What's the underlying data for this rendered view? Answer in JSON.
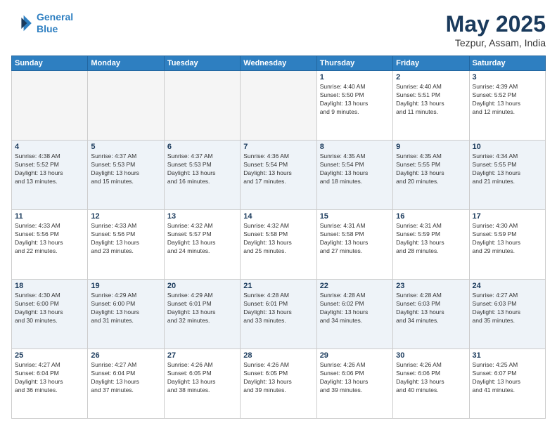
{
  "logo": {
    "line1": "General",
    "line2": "Blue"
  },
  "title": "May 2025",
  "subtitle": "Tezpur, Assam, India",
  "weekdays": [
    "Sunday",
    "Monday",
    "Tuesday",
    "Wednesday",
    "Thursday",
    "Friday",
    "Saturday"
  ],
  "weeks": [
    [
      {
        "day": "",
        "info": ""
      },
      {
        "day": "",
        "info": ""
      },
      {
        "day": "",
        "info": ""
      },
      {
        "day": "",
        "info": ""
      },
      {
        "day": "1",
        "info": "Sunrise: 4:40 AM\nSunset: 5:50 PM\nDaylight: 13 hours\nand 9 minutes."
      },
      {
        "day": "2",
        "info": "Sunrise: 4:40 AM\nSunset: 5:51 PM\nDaylight: 13 hours\nand 11 minutes."
      },
      {
        "day": "3",
        "info": "Sunrise: 4:39 AM\nSunset: 5:52 PM\nDaylight: 13 hours\nand 12 minutes."
      }
    ],
    [
      {
        "day": "4",
        "info": "Sunrise: 4:38 AM\nSunset: 5:52 PM\nDaylight: 13 hours\nand 13 minutes."
      },
      {
        "day": "5",
        "info": "Sunrise: 4:37 AM\nSunset: 5:53 PM\nDaylight: 13 hours\nand 15 minutes."
      },
      {
        "day": "6",
        "info": "Sunrise: 4:37 AM\nSunset: 5:53 PM\nDaylight: 13 hours\nand 16 minutes."
      },
      {
        "day": "7",
        "info": "Sunrise: 4:36 AM\nSunset: 5:54 PM\nDaylight: 13 hours\nand 17 minutes."
      },
      {
        "day": "8",
        "info": "Sunrise: 4:35 AM\nSunset: 5:54 PM\nDaylight: 13 hours\nand 18 minutes."
      },
      {
        "day": "9",
        "info": "Sunrise: 4:35 AM\nSunset: 5:55 PM\nDaylight: 13 hours\nand 20 minutes."
      },
      {
        "day": "10",
        "info": "Sunrise: 4:34 AM\nSunset: 5:55 PM\nDaylight: 13 hours\nand 21 minutes."
      }
    ],
    [
      {
        "day": "11",
        "info": "Sunrise: 4:33 AM\nSunset: 5:56 PM\nDaylight: 13 hours\nand 22 minutes."
      },
      {
        "day": "12",
        "info": "Sunrise: 4:33 AM\nSunset: 5:56 PM\nDaylight: 13 hours\nand 23 minutes."
      },
      {
        "day": "13",
        "info": "Sunrise: 4:32 AM\nSunset: 5:57 PM\nDaylight: 13 hours\nand 24 minutes."
      },
      {
        "day": "14",
        "info": "Sunrise: 4:32 AM\nSunset: 5:58 PM\nDaylight: 13 hours\nand 25 minutes."
      },
      {
        "day": "15",
        "info": "Sunrise: 4:31 AM\nSunset: 5:58 PM\nDaylight: 13 hours\nand 27 minutes."
      },
      {
        "day": "16",
        "info": "Sunrise: 4:31 AM\nSunset: 5:59 PM\nDaylight: 13 hours\nand 28 minutes."
      },
      {
        "day": "17",
        "info": "Sunrise: 4:30 AM\nSunset: 5:59 PM\nDaylight: 13 hours\nand 29 minutes."
      }
    ],
    [
      {
        "day": "18",
        "info": "Sunrise: 4:30 AM\nSunset: 6:00 PM\nDaylight: 13 hours\nand 30 minutes."
      },
      {
        "day": "19",
        "info": "Sunrise: 4:29 AM\nSunset: 6:00 PM\nDaylight: 13 hours\nand 31 minutes."
      },
      {
        "day": "20",
        "info": "Sunrise: 4:29 AM\nSunset: 6:01 PM\nDaylight: 13 hours\nand 32 minutes."
      },
      {
        "day": "21",
        "info": "Sunrise: 4:28 AM\nSunset: 6:01 PM\nDaylight: 13 hours\nand 33 minutes."
      },
      {
        "day": "22",
        "info": "Sunrise: 4:28 AM\nSunset: 6:02 PM\nDaylight: 13 hours\nand 34 minutes."
      },
      {
        "day": "23",
        "info": "Sunrise: 4:28 AM\nSunset: 6:03 PM\nDaylight: 13 hours\nand 34 minutes."
      },
      {
        "day": "24",
        "info": "Sunrise: 4:27 AM\nSunset: 6:03 PM\nDaylight: 13 hours\nand 35 minutes."
      }
    ],
    [
      {
        "day": "25",
        "info": "Sunrise: 4:27 AM\nSunset: 6:04 PM\nDaylight: 13 hours\nand 36 minutes."
      },
      {
        "day": "26",
        "info": "Sunrise: 4:27 AM\nSunset: 6:04 PM\nDaylight: 13 hours\nand 37 minutes."
      },
      {
        "day": "27",
        "info": "Sunrise: 4:26 AM\nSunset: 6:05 PM\nDaylight: 13 hours\nand 38 minutes."
      },
      {
        "day": "28",
        "info": "Sunrise: 4:26 AM\nSunset: 6:05 PM\nDaylight: 13 hours\nand 39 minutes."
      },
      {
        "day": "29",
        "info": "Sunrise: 4:26 AM\nSunset: 6:06 PM\nDaylight: 13 hours\nand 39 minutes."
      },
      {
        "day": "30",
        "info": "Sunrise: 4:26 AM\nSunset: 6:06 PM\nDaylight: 13 hours\nand 40 minutes."
      },
      {
        "day": "31",
        "info": "Sunrise: 4:25 AM\nSunset: 6:07 PM\nDaylight: 13 hours\nand 41 minutes."
      }
    ]
  ]
}
